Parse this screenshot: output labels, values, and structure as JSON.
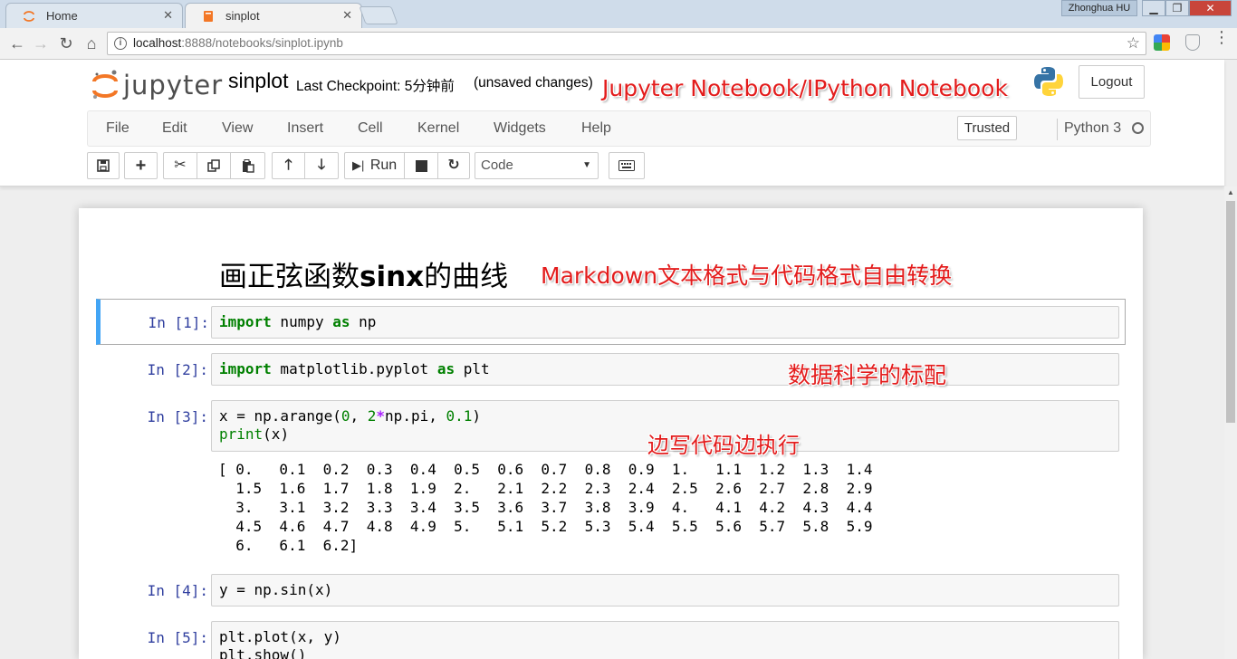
{
  "browser": {
    "tabs": [
      {
        "title": "Home"
      },
      {
        "title": "sinplot"
      }
    ],
    "user": "Zhonghua HU",
    "url_host": "localhost",
    "url_rest": ":8888/notebooks/sinplot.ipynb"
  },
  "header": {
    "logo_text": "jupyter",
    "notebook_name": "sinplot",
    "checkpoint": "Last Checkpoint: 5分钟前",
    "unsaved": "(unsaved changes)",
    "logout_label": "Logout"
  },
  "menu": {
    "items": [
      "File",
      "Edit",
      "View",
      "Insert",
      "Cell",
      "Kernel",
      "Widgets",
      "Help"
    ],
    "trusted": "Trusted",
    "kernel": "Python 3"
  },
  "toolbar": {
    "run_label": "Run",
    "cell_type": "Code"
  },
  "annotations": {
    "title": "Jupyter Notebook/IPython Notebook",
    "markdown": "Markdown文本格式与代码格式自由转换",
    "data_science": "数据科学的标配",
    "execute": "边写代码边执行"
  },
  "notebook": {
    "heading_prefix": "画正弦函数",
    "heading_bold": "sinx",
    "heading_suffix": "的曲线",
    "cells": [
      {
        "prompt": "In [1]:"
      },
      {
        "prompt": "In [2]:"
      },
      {
        "prompt": "In [3]:",
        "output": "[ 0.   0.1  0.2  0.3  0.4  0.5  0.6  0.7  0.8  0.9  1.   1.1  1.2  1.3  1.4\n  1.5  1.6  1.7  1.8  1.9  2.   2.1  2.2  2.3  2.4  2.5  2.6  2.7  2.8  2.9\n  3.   3.1  3.2  3.3  3.4  3.5  3.6  3.7  3.8  3.9  4.   4.1  4.2  4.3  4.4\n  4.5  4.6  4.7  4.8  4.9  5.   5.1  5.2  5.3  5.4  5.5  5.6  5.7  5.8  5.9\n  6.   6.1  6.2]"
      },
      {
        "prompt": "In [4]:"
      },
      {
        "prompt": "In [5]:"
      }
    ]
  }
}
